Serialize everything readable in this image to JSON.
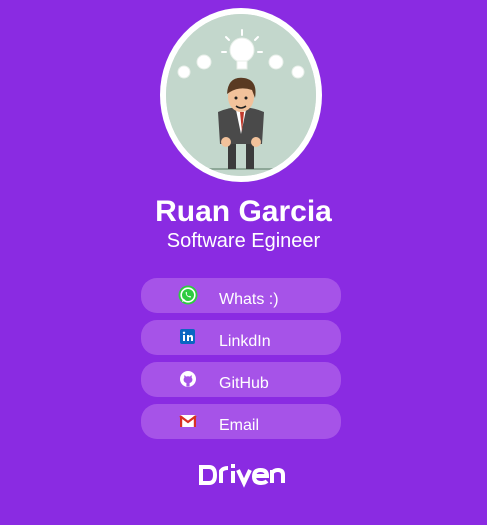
{
  "profile": {
    "name": "Ruan Garcia",
    "role": "Software Egineer"
  },
  "links": [
    {
      "label": "Whats :)",
      "icon": "whatsapp-icon"
    },
    {
      "label": "LinkdIn",
      "icon": "linkedin-icon"
    },
    {
      "label": "GitHub",
      "icon": "github-icon"
    },
    {
      "label": "Email",
      "icon": "gmail-icon"
    }
  ],
  "footer": {
    "logo": "driven"
  },
  "colors": {
    "background": "#8a2be2",
    "button": "#a653e8",
    "text": "#ffffff"
  }
}
